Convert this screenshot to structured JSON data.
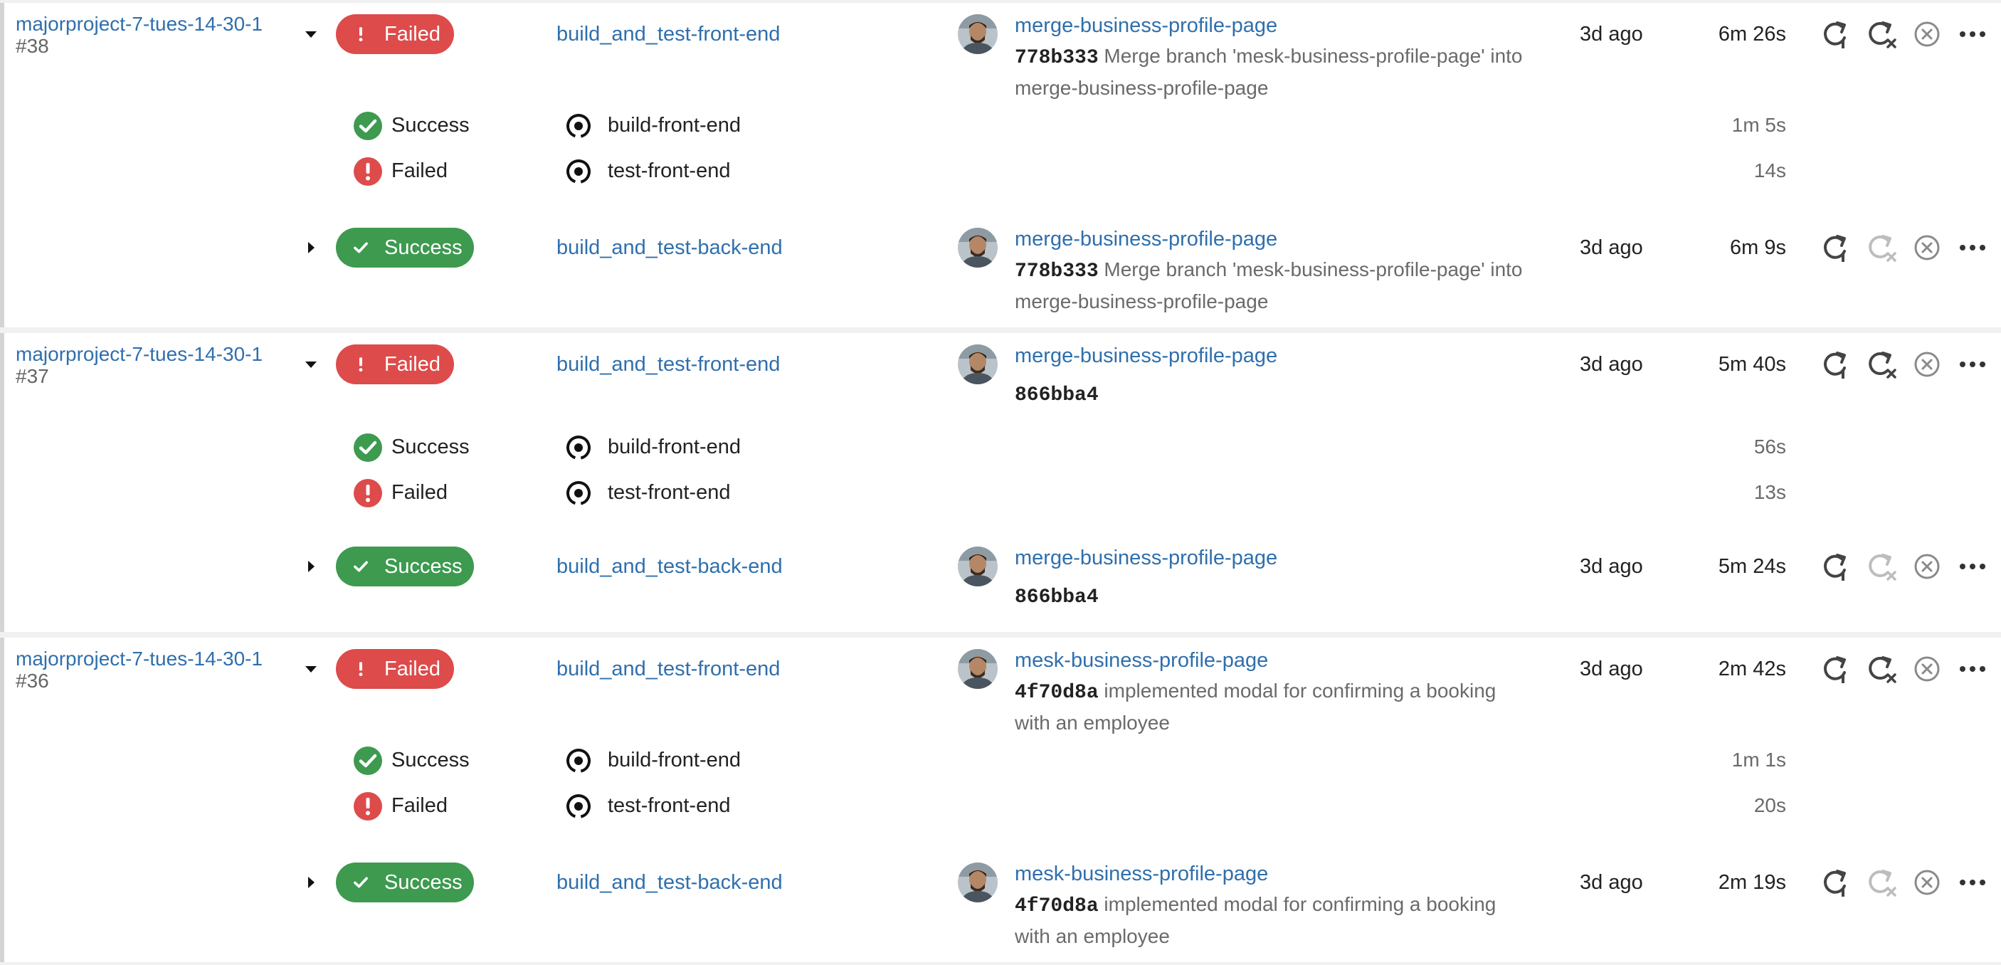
{
  "colors": {
    "link": "#2f6fad",
    "failed": "#dd4b4b",
    "success": "#3d9a4f",
    "muted": "#6a6a6a",
    "icon": "#444444",
    "icon_disabled": "#bdbdbd"
  },
  "icons": {
    "rerun": "rerun-icon",
    "rerun_failed": "rerun-failed-icon",
    "cancel": "cancel-icon",
    "more": "more-icon",
    "stage": "stage-icon",
    "expand": "chevron-down-icon",
    "collapse": "caret-right-icon"
  },
  "groups": [
    {
      "run": {
        "name": "majorproject-7-tues-14-30-1",
        "number": "#38"
      },
      "front": {
        "status": "Failed",
        "job": "build_and_test-front-end",
        "branch": "merge-business-profile-page",
        "sha": "778b333",
        "message": "Merge branch 'mesk-business-profile-page' into merge-business-profile-page",
        "ago": "3d ago",
        "duration": "6m 26s"
      },
      "stages": [
        {
          "status": "Success",
          "name": "build-front-end",
          "duration": "1m 5s"
        },
        {
          "status": "Failed",
          "name": "test-front-end",
          "duration": "14s"
        }
      ],
      "back": {
        "status": "Success",
        "job": "build_and_test-back-end",
        "branch": "merge-business-profile-page",
        "sha": "778b333",
        "message": "Merge branch 'mesk-business-profile-page' into merge-business-profile-page",
        "ago": "3d ago",
        "duration": "6m 9s"
      }
    },
    {
      "run": {
        "name": "majorproject-7-tues-14-30-1",
        "number": "#37"
      },
      "front": {
        "status": "Failed",
        "job": "build_and_test-front-end",
        "branch": "merge-business-profile-page",
        "sha": "866bba4",
        "message": "",
        "ago": "3d ago",
        "duration": "5m 40s"
      },
      "stages": [
        {
          "status": "Success",
          "name": "build-front-end",
          "duration": "56s"
        },
        {
          "status": "Failed",
          "name": "test-front-end",
          "duration": "13s"
        }
      ],
      "back": {
        "status": "Success",
        "job": "build_and_test-back-end",
        "branch": "merge-business-profile-page",
        "sha": "866bba4",
        "message": "",
        "ago": "3d ago",
        "duration": "5m 24s"
      }
    },
    {
      "run": {
        "name": "majorproject-7-tues-14-30-1",
        "number": "#36"
      },
      "front": {
        "status": "Failed",
        "job": "build_and_test-front-end",
        "branch": "mesk-business-profile-page",
        "sha": "4f70d8a",
        "message": "implemented modal for confirming a booking with an employee",
        "ago": "3d ago",
        "duration": "2m 42s"
      },
      "stages": [
        {
          "status": "Success",
          "name": "build-front-end",
          "duration": "1m 1s"
        },
        {
          "status": "Failed",
          "name": "test-front-end",
          "duration": "20s"
        }
      ],
      "back": {
        "status": "Success",
        "job": "build_and_test-back-end",
        "branch": "mesk-business-profile-page",
        "sha": "4f70d8a",
        "message": "implemented modal for confirming a booking with an employee",
        "ago": "3d ago",
        "duration": "2m 19s"
      }
    }
  ]
}
